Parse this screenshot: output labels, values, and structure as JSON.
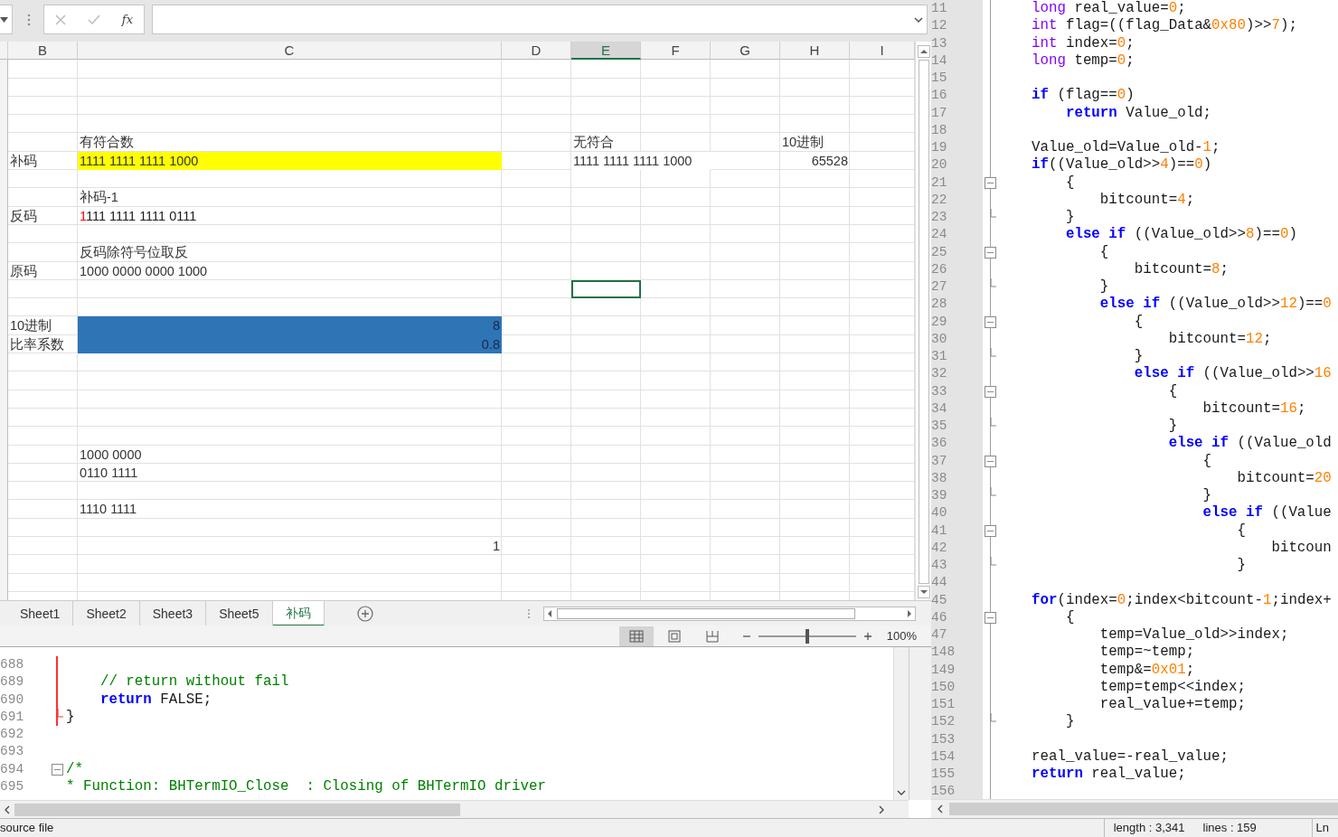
{
  "spreadsheet": {
    "formula_bar": {
      "function_label": "fx"
    },
    "columns": [
      {
        "label": "B",
        "selected": false
      },
      {
        "label": "C",
        "selected": false
      },
      {
        "label": "D",
        "selected": false
      },
      {
        "label": "E",
        "selected": true
      },
      {
        "label": "F",
        "selected": false
      },
      {
        "label": "G",
        "selected": false
      },
      {
        "label": "H",
        "selected": false
      },
      {
        "label": "I",
        "selected": false
      }
    ],
    "rows": [
      {},
      {},
      {},
      {},
      {
        "cells": {
          "c": {
            "text": "有符合数",
            "selected": false
          },
          "e": {
            "text": "无符合",
            "selected": false
          },
          "h": {
            "text": "10进制",
            "selected": false
          }
        }
      },
      {
        "cells": {
          "b": {
            "text": "补码",
            "selected": false
          },
          "c": {
            "text": "1111 1111 1111 1000",
            "color": "#ffff00",
            "selected": false
          },
          "e": {
            "text": "1111 1111 1111 1000",
            "selected": false
          },
          "h": {
            "text": "65528",
            "right_aligned": true,
            "selected": false
          }
        }
      },
      {},
      {
        "cells": {
          "c": {
            "text": "补码-1",
            "selected": false
          }
        }
      },
      {
        "cells": {
          "b": {
            "text": "反码",
            "selected": false
          },
          "c": {
            "runs": [
              {
                "text": "1",
                "kind": "accent"
              },
              {
                "text": "111 1111 1111 0111",
                "kind": "plain"
              }
            ],
            "selected": false
          }
        }
      },
      {},
      {
        "cells": {
          "c": {
            "text": "反码除符号位取反",
            "selected": false
          }
        }
      },
      {
        "cells": {
          "b": {
            "text": "原码",
            "selected": false
          },
          "c": {
            "text": "1000 0000 0000 1000",
            "selected": false
          }
        }
      },
      {
        "cells": {
          "e": {
            "selected": true
          }
        }
      },
      {},
      {
        "cells": {
          "b": {
            "text": "10进制",
            "selected": false
          },
          "c": {
            "text": "8",
            "color": "#2e75b6",
            "right_aligned": true,
            "selected": false
          }
        }
      },
      {
        "cells": {
          "b": {
            "text": "比率系数",
            "selected": false
          },
          "c": {
            "text": "0.8",
            "color": "#2e75b6",
            "right_aligned": true,
            "selected": false
          }
        }
      },
      {},
      {},
      {},
      {},
      {},
      {
        "cells": {
          "c": {
            "text": "1000 0000",
            "selected": false
          }
        }
      },
      {
        "cells": {
          "c": {
            "text": "0110 1111",
            "selected": false
          }
        }
      },
      {},
      {
        "cells": {
          "c": {
            "text": "1110 1111",
            "selected": false
          }
        }
      },
      {},
      {
        "cells": {
          "c": {
            "text": "1",
            "right_aligned": true,
            "selected": false
          }
        }
      },
      {},
      {},
      {}
    ],
    "sheet_tabs": [
      {
        "label": "Sheet1",
        "selected": false
      },
      {
        "label": "Sheet2",
        "selected": false
      },
      {
        "label": "Sheet3",
        "selected": false
      },
      {
        "label": "Sheet5",
        "selected": false
      },
      {
        "label": "补码",
        "selected": true
      }
    ],
    "views": [
      {
        "selected": true
      },
      {
        "selected": false
      },
      {
        "selected": false
      }
    ],
    "zoom": {
      "level": 0.5,
      "reading": "100%"
    }
  },
  "left_editor": {
    "lines": [
      {
        "number": "688",
        "changed": true
      },
      {
        "number": "689",
        "changed": true,
        "tokens": [
          {
            "kind": "comment",
            "text": "    // return without fail"
          }
        ]
      },
      {
        "number": "690",
        "changed": true,
        "tokens": [
          {
            "kind": "keyword",
            "text": "    return"
          },
          {
            "kind": "plain",
            "text": " FALSE;"
          }
        ]
      },
      {
        "number": "691",
        "changed": true,
        "fold_end": true,
        "tokens": [
          {
            "kind": "plain",
            "text": "}"
          }
        ]
      },
      {
        "number": "692",
        "changed": false
      },
      {
        "number": "693",
        "changed": false
      },
      {
        "number": "694",
        "changed": false,
        "fold_start": true,
        "tokens": [
          {
            "kind": "comment",
            "text": "/*"
          }
        ]
      },
      {
        "number": "695",
        "changed": false,
        "tokens": [
          {
            "kind": "comment",
            "text": "* Function: BHTermIO_Close  : Closing of BHTermIO driver"
          }
        ]
      }
    ]
  },
  "right_editor": {
    "lines": [
      {
        "number": "11",
        "tokens": [
          {
            "kind": "type",
            "text": "long"
          },
          {
            "kind": "plain",
            "text": " real_value="
          },
          {
            "kind": "number",
            "text": "0"
          },
          {
            "kind": "plain",
            "text": ";"
          }
        ]
      },
      {
        "number": "12",
        "tokens": [
          {
            "kind": "type",
            "text": "int"
          },
          {
            "kind": "plain",
            "text": " flag=((flag_Data&"
          },
          {
            "kind": "number",
            "text": "0x80"
          },
          {
            "kind": "plain",
            "text": ")>>"
          },
          {
            "kind": "number",
            "text": "7"
          },
          {
            "kind": "plain",
            "text": ");"
          }
        ]
      },
      {
        "number": "13",
        "tokens": [
          {
            "kind": "type",
            "text": "int"
          },
          {
            "kind": "plain",
            "text": " index="
          },
          {
            "kind": "number",
            "text": "0"
          },
          {
            "kind": "plain",
            "text": ";"
          }
        ]
      },
      {
        "number": "14",
        "tokens": [
          {
            "kind": "type",
            "text": "long"
          },
          {
            "kind": "plain",
            "text": " temp="
          },
          {
            "kind": "number",
            "text": "0"
          },
          {
            "kind": "plain",
            "text": ";"
          }
        ]
      },
      {
        "number": "15"
      },
      {
        "number": "16",
        "tokens": [
          {
            "kind": "keyword",
            "text": "if"
          },
          {
            "kind": "plain",
            "text": " (flag=="
          },
          {
            "kind": "number",
            "text": "0"
          },
          {
            "kind": "plain",
            "text": ")"
          }
        ]
      },
      {
        "number": "17",
        "tokens": [
          {
            "kind": "keyword",
            "text": "    return"
          },
          {
            "kind": "plain",
            "text": " Value_old;"
          }
        ]
      },
      {
        "number": "18"
      },
      {
        "number": "19",
        "tokens": [
          {
            "kind": "plain",
            "text": "Value_old=Value_old-"
          },
          {
            "kind": "number",
            "text": "1"
          },
          {
            "kind": "plain",
            "text": ";"
          }
        ]
      },
      {
        "number": "20",
        "tokens": [
          {
            "kind": "keyword",
            "text": "if"
          },
          {
            "kind": "plain",
            "text": "((Value_old>>"
          },
          {
            "kind": "number",
            "text": "4"
          },
          {
            "kind": "plain",
            "text": ")=="
          },
          {
            "kind": "number",
            "text": "0"
          },
          {
            "kind": "plain",
            "text": ")"
          }
        ]
      },
      {
        "number": "21",
        "fold_start": true,
        "tokens": [
          {
            "kind": "plain",
            "text": "    {"
          }
        ]
      },
      {
        "number": "22",
        "tokens": [
          {
            "kind": "plain",
            "text": "        bitcount="
          },
          {
            "kind": "number",
            "text": "4"
          },
          {
            "kind": "plain",
            "text": ";"
          }
        ]
      },
      {
        "number": "23",
        "fold_end": true,
        "tokens": [
          {
            "kind": "plain",
            "text": "    }"
          }
        ]
      },
      {
        "number": "24",
        "tokens": [
          {
            "kind": "keyword",
            "text": "    else if"
          },
          {
            "kind": "plain",
            "text": " ((Value_old>>"
          },
          {
            "kind": "number",
            "text": "8"
          },
          {
            "kind": "plain",
            "text": ")=="
          },
          {
            "kind": "number",
            "text": "0"
          },
          {
            "kind": "plain",
            "text": ")"
          }
        ]
      },
      {
        "number": "25",
        "fold_start": true,
        "tokens": [
          {
            "kind": "plain",
            "text": "        {"
          }
        ]
      },
      {
        "number": "26",
        "tokens": [
          {
            "kind": "plain",
            "text": "            bitcount="
          },
          {
            "kind": "number",
            "text": "8"
          },
          {
            "kind": "plain",
            "text": ";"
          }
        ]
      },
      {
        "number": "27",
        "fold_end": true,
        "tokens": [
          {
            "kind": "plain",
            "text": "        }"
          }
        ]
      },
      {
        "number": "28",
        "tokens": [
          {
            "kind": "keyword",
            "text": "        else if"
          },
          {
            "kind": "plain",
            "text": " ((Value_old>>"
          },
          {
            "kind": "number",
            "text": "12"
          },
          {
            "kind": "plain",
            "text": ")=="
          },
          {
            "kind": "number",
            "text": "0"
          }
        ]
      },
      {
        "number": "29",
        "fold_start": true,
        "tokens": [
          {
            "kind": "plain",
            "text": "            {"
          }
        ]
      },
      {
        "number": "30",
        "tokens": [
          {
            "kind": "plain",
            "text": "                bitcount="
          },
          {
            "kind": "number",
            "text": "12"
          },
          {
            "kind": "plain",
            "text": ";"
          }
        ]
      },
      {
        "number": "31",
        "fold_end": true,
        "tokens": [
          {
            "kind": "plain",
            "text": "            }"
          }
        ]
      },
      {
        "number": "32",
        "tokens": [
          {
            "kind": "keyword",
            "text": "            else if"
          },
          {
            "kind": "plain",
            "text": " ((Value_old>>"
          },
          {
            "kind": "number",
            "text": "16"
          }
        ]
      },
      {
        "number": "33",
        "fold_start": true,
        "tokens": [
          {
            "kind": "plain",
            "text": "                {"
          }
        ]
      },
      {
        "number": "34",
        "tokens": [
          {
            "kind": "plain",
            "text": "                    bitcount="
          },
          {
            "kind": "number",
            "text": "16"
          },
          {
            "kind": "plain",
            "text": ";"
          }
        ]
      },
      {
        "number": "35",
        "fold_end": true,
        "tokens": [
          {
            "kind": "plain",
            "text": "                }"
          }
        ]
      },
      {
        "number": "36",
        "tokens": [
          {
            "kind": "keyword",
            "text": "                else if"
          },
          {
            "kind": "plain",
            "text": " ((Value_old"
          }
        ]
      },
      {
        "number": "37",
        "fold_start": true,
        "tokens": [
          {
            "kind": "plain",
            "text": "                    {"
          }
        ]
      },
      {
        "number": "38",
        "tokens": [
          {
            "kind": "plain",
            "text": "                        bitcount="
          },
          {
            "kind": "number",
            "text": "20"
          }
        ]
      },
      {
        "number": "39",
        "fold_end": true,
        "tokens": [
          {
            "kind": "plain",
            "text": "                    }"
          }
        ]
      },
      {
        "number": "40",
        "tokens": [
          {
            "kind": "keyword",
            "text": "                    else if"
          },
          {
            "kind": "plain",
            "text": " ((Value"
          }
        ]
      },
      {
        "number": "41",
        "fold_start": true,
        "tokens": [
          {
            "kind": "plain",
            "text": "                        {"
          }
        ]
      },
      {
        "number": "42",
        "tokens": [
          {
            "kind": "plain",
            "text": "                            bitcoun"
          }
        ]
      },
      {
        "number": "43",
        "fold_end": true,
        "tokens": [
          {
            "kind": "plain",
            "text": "                        }"
          }
        ]
      },
      {
        "number": "44"
      },
      {
        "number": "45",
        "tokens": [
          {
            "kind": "keyword",
            "text": "for"
          },
          {
            "kind": "plain",
            "text": "(index="
          },
          {
            "kind": "number",
            "text": "0"
          },
          {
            "kind": "plain",
            "text": ";index<bitcount-"
          },
          {
            "kind": "number",
            "text": "1"
          },
          {
            "kind": "plain",
            "text": ";index+"
          }
        ]
      },
      {
        "number": "46",
        "fold_start": true,
        "tokens": [
          {
            "kind": "plain",
            "text": "    {"
          }
        ]
      },
      {
        "number": "47",
        "tokens": [
          {
            "kind": "plain",
            "text": "        temp=Value_old>>index;"
          }
        ]
      },
      {
        "number": "148",
        "tokens": [
          {
            "kind": "plain",
            "text": "        temp=~temp;"
          }
        ]
      },
      {
        "number": "149",
        "tokens": [
          {
            "kind": "plain",
            "text": "        temp&="
          },
          {
            "kind": "number",
            "text": "0x01"
          },
          {
            "kind": "plain",
            "text": ";"
          }
        ]
      },
      {
        "number": "150",
        "tokens": [
          {
            "kind": "plain",
            "text": "        temp=temp<<index;"
          }
        ]
      },
      {
        "number": "151",
        "tokens": [
          {
            "kind": "plain",
            "text": "        real_value+=temp;"
          }
        ]
      },
      {
        "number": "152",
        "fold_end": true,
        "tokens": [
          {
            "kind": "plain",
            "text": "    }"
          }
        ]
      },
      {
        "number": "153"
      },
      {
        "number": "154",
        "tokens": [
          {
            "kind": "plain",
            "text": "real_value=-real_value;"
          }
        ]
      },
      {
        "number": "155",
        "tokens": [
          {
            "kind": "keyword",
            "text": "return"
          },
          {
            "kind": "plain",
            "text": " real_value;"
          }
        ]
      },
      {
        "number": "156"
      }
    ]
  },
  "status_bar": {
    "message": "source file",
    "length": "length : 3,341",
    "lines": "lines : 159",
    "position": "Ln"
  }
}
